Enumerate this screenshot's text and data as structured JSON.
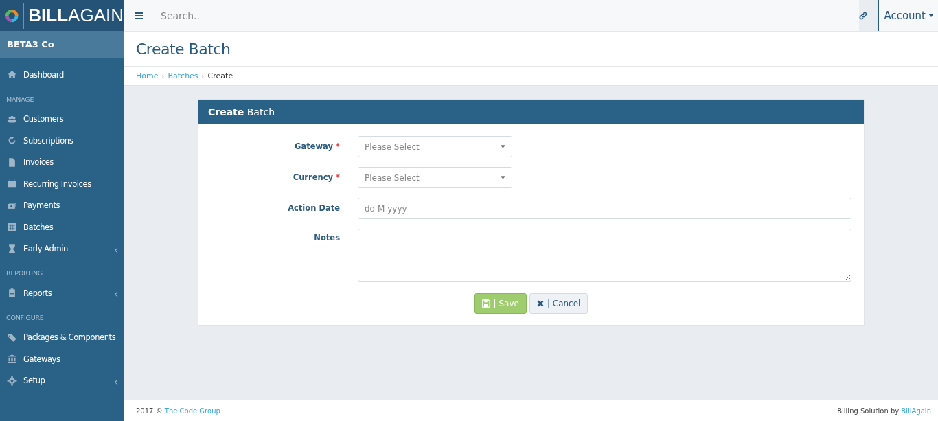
{
  "logo": {
    "text": "**BILL**AGAIN"
  },
  "search": {
    "placeholder": "Search.."
  },
  "account": {
    "label": "Account"
  },
  "company": "BETA3 Co",
  "sidebar": {
    "items": [
      {
        "kind": "item",
        "label": "Dashboard",
        "expandable": false
      },
      {
        "kind": "section",
        "label": "MANAGE"
      },
      {
        "kind": "item",
        "label": "Customers",
        "expandable": false
      },
      {
        "kind": "item",
        "label": "Subscriptions",
        "expandable": false
      },
      {
        "kind": "item",
        "label": "Invoices",
        "expandable": false
      },
      {
        "kind": "item",
        "label": "Recurring Invoices",
        "expandable": false
      },
      {
        "kind": "item",
        "label": "Payments",
        "expandable": false
      },
      {
        "kind": "item",
        "label": "Batches",
        "expandable": false
      },
      {
        "kind": "item",
        "label": "Early Admin",
        "expandable": true
      },
      {
        "kind": "section",
        "label": "REPORTING"
      },
      {
        "kind": "item",
        "label": "Reports",
        "expandable": true
      },
      {
        "kind": "section",
        "label": "CONFIGURE"
      },
      {
        "kind": "item",
        "label": "Packages & Components",
        "expandable": false
      },
      {
        "kind": "item",
        "label": "Gateways",
        "expandable": false
      },
      {
        "kind": "item",
        "label": "Setup",
        "expandable": true
      }
    ]
  },
  "page_title": "Create Batch",
  "breadcrumb": [
    {
      "label": "Home",
      "link": true
    },
    {
      "separator": "›",
      "label": "Batches",
      "link": true
    },
    {
      "separator": "›",
      "label": "Create",
      "link": false
    }
  ],
  "panel": {
    "title": "**Create** Batch",
    "fields": [
      {
        "kind": "select",
        "label": "Gateway",
        "marker": "*",
        "placeholder": "Please Select"
      },
      {
        "kind": "select",
        "label": "Currency",
        "marker": "*",
        "placeholder": "Please Select"
      },
      {
        "kind": "date",
        "label": "Action Date",
        "placeholder": "dd M yyyy"
      },
      {
        "kind": "textarea",
        "label": "Notes"
      }
    ],
    "buttons": [
      {
        "kind": "save",
        "label": "| Save"
      },
      {
        "kind": "cancel",
        "label": "| Cancel"
      }
    ]
  },
  "footer": {
    "left_text": "2017 © ",
    "left_link": "The Code Group",
    "right_text": "Billing Solution by ",
    "right_link": "BillAgain"
  }
}
